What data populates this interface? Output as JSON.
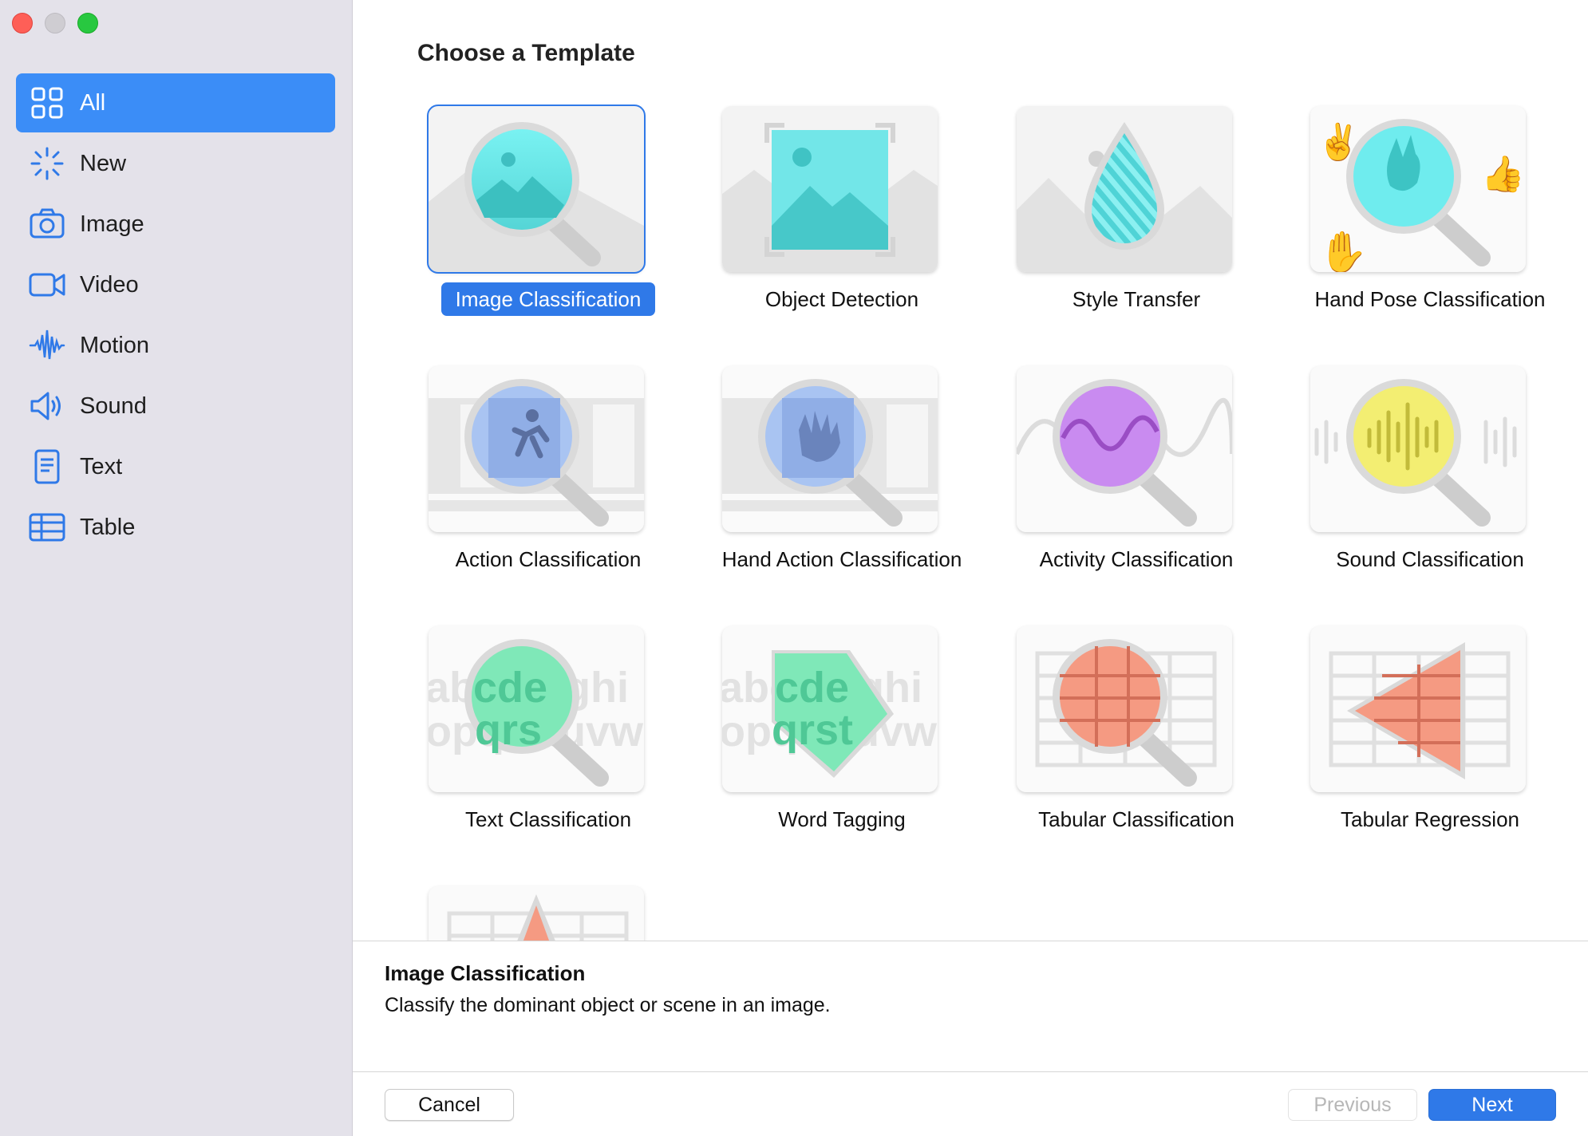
{
  "sidebar": {
    "items": [
      {
        "label": "All",
        "icon": "grid-icon",
        "active": true
      },
      {
        "label": "New",
        "icon": "sparkle-icon",
        "active": false
      },
      {
        "label": "Image",
        "icon": "camera-icon",
        "active": false
      },
      {
        "label": "Video",
        "icon": "video-camera-icon",
        "active": false
      },
      {
        "label": "Motion",
        "icon": "waveform-icon",
        "active": false
      },
      {
        "label": "Sound",
        "icon": "speaker-icon",
        "active": false
      },
      {
        "label": "Text",
        "icon": "document-icon",
        "active": false
      },
      {
        "label": "Table",
        "icon": "table-icon",
        "active": false
      }
    ]
  },
  "main": {
    "heading": "Choose a Template",
    "templates": [
      {
        "label": "Image Classification",
        "selected": true
      },
      {
        "label": "Object Detection"
      },
      {
        "label": "Style Transfer"
      },
      {
        "label": "Hand Pose Classification"
      },
      {
        "label": "Action Classification"
      },
      {
        "label": "Hand Action Classification"
      },
      {
        "label": "Activity Classification"
      },
      {
        "label": "Sound Classification"
      },
      {
        "label": "Text Classification"
      },
      {
        "label": "Word Tagging"
      },
      {
        "label": "Tabular Classification"
      },
      {
        "label": "Tabular Regression"
      }
    ],
    "thumb_text": {
      "row1": "abcdefghi",
      "row2": "opqrstuvw"
    }
  },
  "description": {
    "title": "Image Classification",
    "text": "Classify the dominant object or scene in an image."
  },
  "footer": {
    "cancel_label": "Cancel",
    "previous_label": "Previous",
    "next_label": "Next"
  },
  "colors": {
    "accent": "#2f79e8",
    "sidebar_active": "#3b8df7",
    "icon_blue": "#2f79e8",
    "cyan": "#5fe8ee",
    "purple": "#c98bf0",
    "yellow": "#f3ee72",
    "mint": "#7fe8b8",
    "salmon": "#f59a82"
  }
}
